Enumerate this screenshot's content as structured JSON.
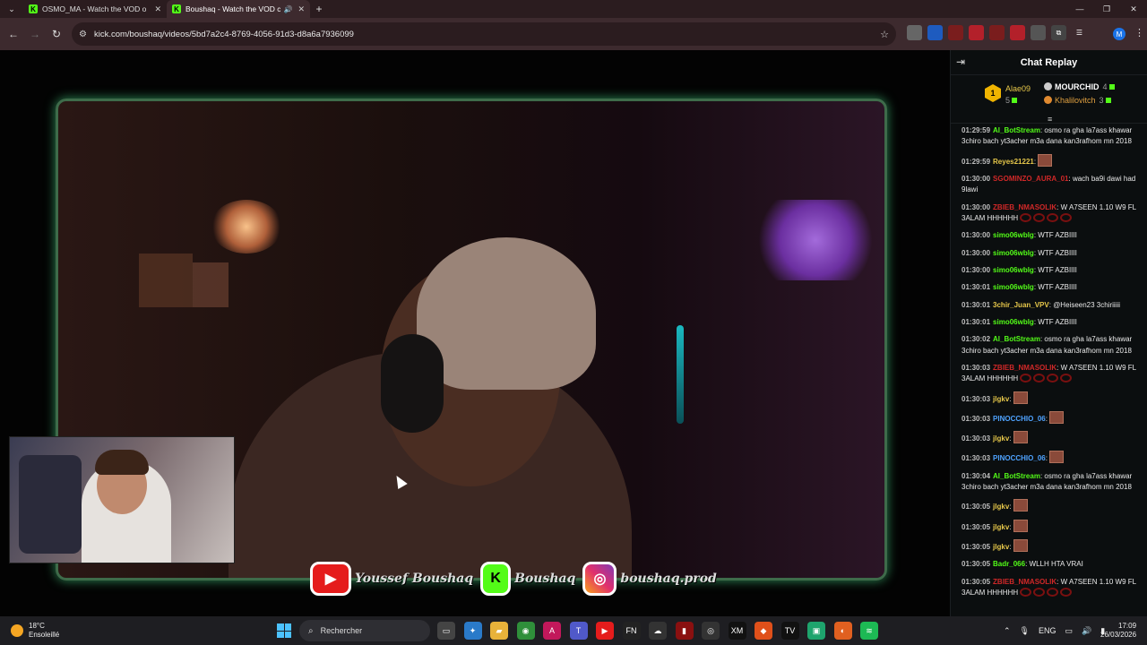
{
  "browser": {
    "tabs": [
      {
        "title": "OSMO_MA - Watch the VOD o",
        "active": false
      },
      {
        "title": "Boushaq - Watch the VOD c",
        "active": true
      }
    ],
    "url": "kick.com/boushaq/videos/5bd7a2c4-8769-4056-91d3-d8a6a7936099",
    "profile_initial": "M"
  },
  "stream": {
    "socials": [
      {
        "icon": "youtube-icon",
        "label": "Youssef Boushaq",
        "color": "#e51c1c"
      },
      {
        "icon": "kick-icon",
        "label": "Boushaq",
        "color": "#53fc18"
      },
      {
        "icon": "instagram-icon",
        "label": "boushaq.prod",
        "color": "#e1306c"
      }
    ]
  },
  "chat": {
    "title": "Chat Replay",
    "leaders": [
      {
        "rank": "1",
        "name": "Alae09",
        "count": "5"
      },
      {
        "rank": "2",
        "name": "MOURCHID",
        "count": "4"
      },
      {
        "rank": "3",
        "name": "Khalilovitch",
        "count": "3"
      }
    ],
    "messages": [
      {
        "time": "01:29:59",
        "user": "Al_BotStream",
        "color": "#53fc18",
        "text": "osmo ra gha la7ass khawar 3chiro bach yt3acher m3a dana kan3rafhom mn 2018",
        "emotes": 0,
        "red": 0
      },
      {
        "time": "01:29:59",
        "user": "Reyes21221",
        "color": "#e6c74a",
        "text": "",
        "emotes": 1,
        "red": 0
      },
      {
        "time": "01:30:00",
        "user": "SGOMINZO_AURA_01",
        "color": "#d02828",
        "text": "wach ba9i dawi had 9lawi",
        "emotes": 0,
        "red": 0
      },
      {
        "time": "01:30:00",
        "user": "ZBIEB_NMASOLIK",
        "color": "#d02828",
        "text": "W A7SEEN 1.10 W9 FL 3ALAM HHHHHH",
        "emotes": 0,
        "red": 4
      },
      {
        "time": "01:30:00",
        "user": "simo06wblg",
        "color": "#53fc18",
        "text": "WTF AZBIIII",
        "emotes": 0,
        "red": 0
      },
      {
        "time": "01:30:00",
        "user": "simo06wblg",
        "color": "#53fc18",
        "text": "WTF AZBIIII",
        "emotes": 0,
        "red": 0
      },
      {
        "time": "01:30:00",
        "user": "simo06wblg",
        "color": "#53fc18",
        "text": "WTF AZBIIII",
        "emotes": 0,
        "red": 0
      },
      {
        "time": "01:30:01",
        "user": "simo06wblg",
        "color": "#53fc18",
        "text": "WTF AZBIIII",
        "emotes": 0,
        "red": 0
      },
      {
        "time": "01:30:01",
        "user": "3chir_Juan_VPV",
        "color": "#e6c74a",
        "text": "@Heiseen23 3chiriiiii",
        "emotes": 0,
        "red": 0
      },
      {
        "time": "01:30:01",
        "user": "simo06wblg",
        "color": "#53fc18",
        "text": "WTF AZBIIII",
        "emotes": 0,
        "red": 0
      },
      {
        "time": "01:30:02",
        "user": "Al_BotStream",
        "color": "#53fc18",
        "text": "osmo ra gha la7ass khawar 3chiro bach yt3acher m3a dana kan3rafhom mn 2018",
        "emotes": 0,
        "red": 0
      },
      {
        "time": "01:30:03",
        "user": "ZBIEB_NMASOLIK",
        "color": "#d02828",
        "text": "W A7SEEN 1.10 W9 FL 3ALAM HHHHHH",
        "emotes": 0,
        "red": 4
      },
      {
        "time": "01:30:03",
        "user": "jlgkv",
        "color": "#e6c74a",
        "text": "",
        "emotes": 1,
        "red": 0
      },
      {
        "time": "01:30:03",
        "user": "PINOCCHIO_06",
        "color": "#4fa3ff",
        "text": "",
        "emotes": 1,
        "red": 0
      },
      {
        "time": "01:30:03",
        "user": "jlgkv",
        "color": "#e6c74a",
        "text": "",
        "emotes": 1,
        "red": 0
      },
      {
        "time": "01:30:03",
        "user": "PINOCCHIO_06",
        "color": "#4fa3ff",
        "text": "",
        "emotes": 1,
        "red": 0
      },
      {
        "time": "01:30:04",
        "user": "Al_BotStream",
        "color": "#53fc18",
        "text": "osmo ra gha la7ass khawar 3chiro bach yt3acher m3a dana kan3rafhom mn 2018",
        "emotes": 0,
        "red": 0
      },
      {
        "time": "01:30:05",
        "user": "jlgkv",
        "color": "#e6c74a",
        "text": "",
        "emotes": 1,
        "red": 0
      },
      {
        "time": "01:30:05",
        "user": "jlgkv",
        "color": "#e6c74a",
        "text": "",
        "emotes": 1,
        "red": 0
      },
      {
        "time": "01:30:05",
        "user": "jlgkv",
        "color": "#e6c74a",
        "text": "",
        "emotes": 1,
        "red": 0
      },
      {
        "time": "01:30:05",
        "user": "Badr_066",
        "color": "#53fc18",
        "text": "WLLH HTA VRAI",
        "emotes": 0,
        "red": 0
      },
      {
        "time": "01:30:05",
        "user": "ZBIEB_NMASOLIK",
        "color": "#d02828",
        "text": "W A7SEEN 1.10 W9 FL 3ALAM HHHHHH",
        "emotes": 0,
        "red": 4
      }
    ]
  },
  "taskbar": {
    "temperature": "18°C",
    "weather": "Ensoleillé",
    "search_placeholder": "Rechercher",
    "language": "ENG",
    "time": "17:09",
    "date": "26/03/2026"
  }
}
